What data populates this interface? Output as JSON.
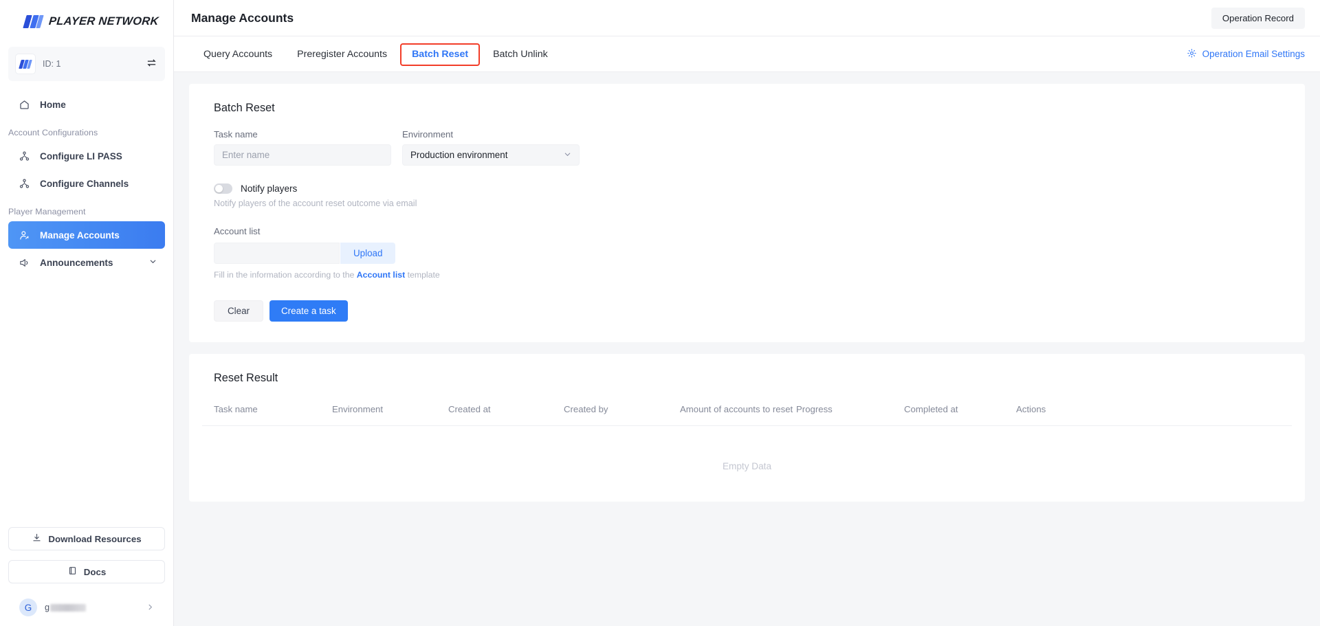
{
  "brand": {
    "name": "PLAYER NETWORK",
    "logo_icon": "player-network-logo-icon"
  },
  "project": {
    "id_label": "ID: 1",
    "name_redacted": true,
    "swap_icon": "swap-horizontal-icon"
  },
  "sidebar": {
    "items": [
      {
        "label": "Home",
        "icon": "home-icon",
        "active": false
      },
      {
        "label": "Configure LI PASS",
        "icon": "node-tree-icon",
        "active": false
      },
      {
        "label": "Configure Channels",
        "icon": "node-tree-icon",
        "active": false
      },
      {
        "label": "Manage Accounts",
        "icon": "user-settings-icon",
        "active": true
      },
      {
        "label": "Announcements",
        "icon": "megaphone-icon",
        "active": false,
        "expandable": true
      }
    ],
    "sections": [
      {
        "label": "Account Configurations"
      },
      {
        "label": "Player Management"
      }
    ],
    "bottom_buttons": [
      {
        "label": "Download Resources",
        "icon": "download-icon"
      },
      {
        "label": "Docs",
        "icon": "book-icon"
      }
    ],
    "user": {
      "avatar_letter": "G",
      "name_visible": "g",
      "name_redacted": true,
      "chevron_icon": "chevron-right-icon"
    }
  },
  "header": {
    "title": "Manage Accounts",
    "operation_record_label": "Operation Record"
  },
  "tabs": [
    {
      "label": "Query Accounts",
      "active": false
    },
    {
      "label": "Preregister Accounts",
      "active": false
    },
    {
      "label": "Batch Reset",
      "active": true,
      "annotated": true
    },
    {
      "label": "Batch Unlink",
      "active": false
    }
  ],
  "email_settings": {
    "label": "Operation Email Settings",
    "icon": "gear-icon"
  },
  "batch_reset": {
    "card_title": "Batch Reset",
    "task_name": {
      "label": "Task name",
      "value": "",
      "placeholder": "Enter name"
    },
    "environment": {
      "label": "Environment",
      "value": "Production environment",
      "options": [
        "Production environment"
      ],
      "chevron_icon": "chevron-down-icon"
    },
    "notify": {
      "label": "Notify players",
      "enabled": false,
      "hint": "Notify players of the account reset outcome via email"
    },
    "account_list": {
      "label": "Account list",
      "value": "",
      "upload_label": "Upload",
      "hint_prefix": "Fill in the information according to the ",
      "hint_link": "Account list",
      "hint_suffix": " template"
    },
    "buttons": {
      "clear": "Clear",
      "create": "Create a task"
    }
  },
  "reset_result": {
    "card_title": "Reset Result",
    "columns": [
      "Task name",
      "Environment",
      "Created at",
      "Created by",
      "Amount of accounts to reset",
      "Progress",
      "Completed at",
      "Actions"
    ],
    "rows": [],
    "empty_text": "Empty Data"
  },
  "colors": {
    "accent": "#2f7cf6",
    "accent_link": "#2f76f6",
    "annotation": "#f23d28",
    "sidebar_active_from": "#4f96f5",
    "sidebar_active_to": "#3b7cf0",
    "page_bg": "#f5f6f8",
    "text_primary": "#1d2129",
    "text_muted": "#858a99"
  }
}
